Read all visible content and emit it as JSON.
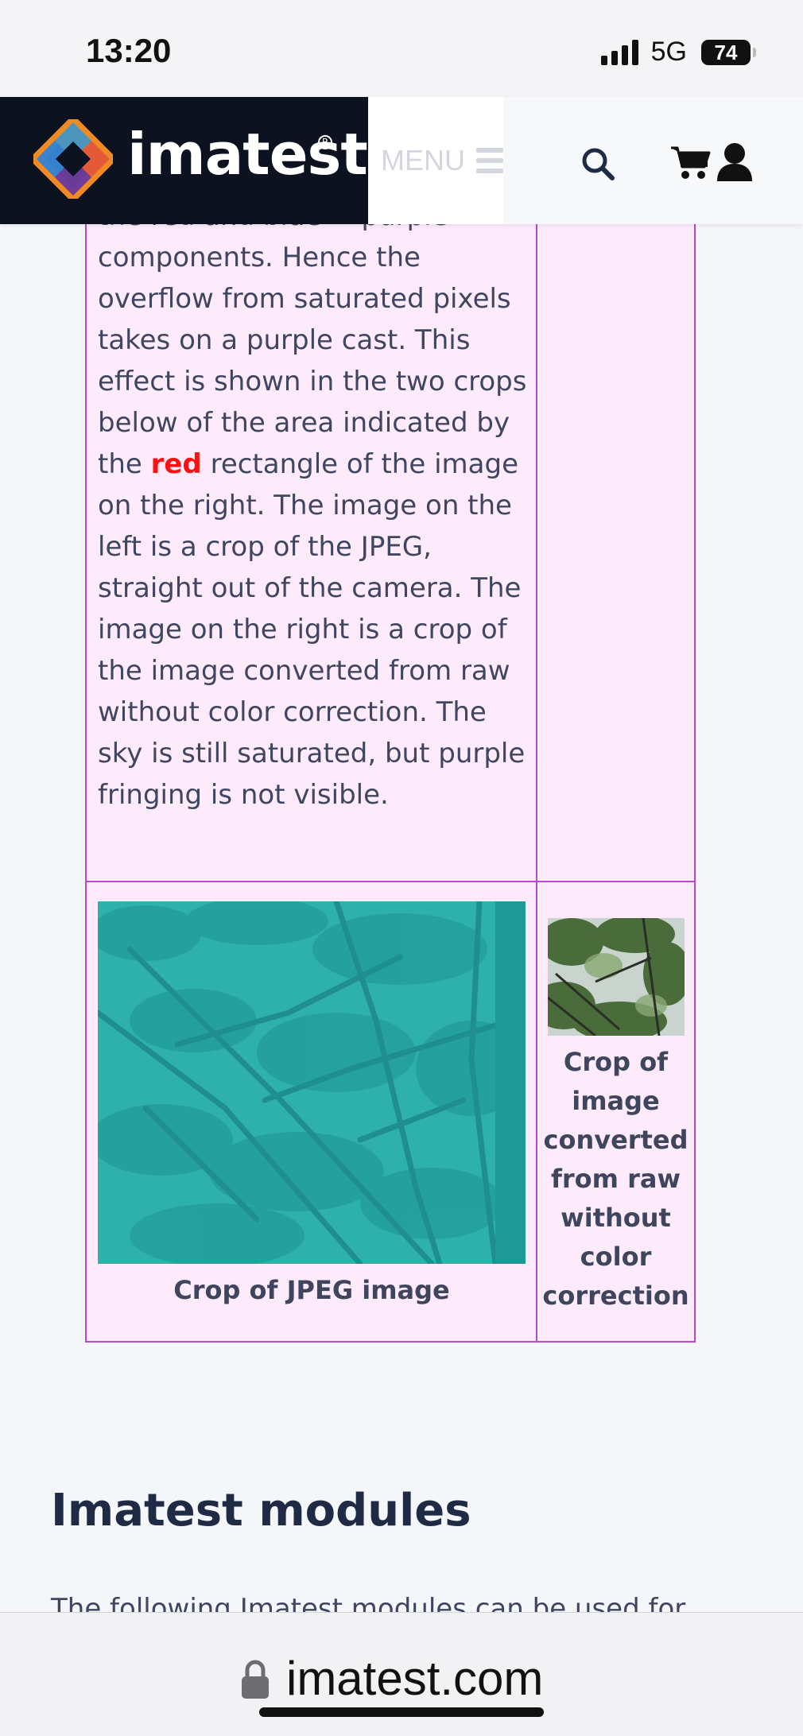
{
  "status_bar": {
    "time": "13:20",
    "network": "5G",
    "battery": "74"
  },
  "header": {
    "logo_text": "imatest",
    "menu_label": "MENU",
    "icons": [
      "logo-mark",
      "hamburger-icon",
      "search-icon",
      "cart-icon",
      "user-icon"
    ]
  },
  "article": {
    "paragraph_before_red": "the red and blue = purple components. Hence the overflow from saturated pixels takes on a purple cast. This effect is shown in the two crops below of the area indicated by the ",
    "paragraph_red": "red",
    "paragraph_after_red": " rectangle of the image on the right. The image on the left is a crop of the JPEG, straight out of the camera. The image on the right is a crop of the image converted from raw without color correction. The sky is still saturated, but purple fringing is not visible.",
    "caption_left": "Crop of JPEG image",
    "caption_right": "Crop of image converted from raw without color correction"
  },
  "modules": {
    "heading": "Imatest modules",
    "intro_partial": "The following Imatest modules can be used for"
  },
  "browser": {
    "url": "imatest.com"
  },
  "colors": {
    "table_border": "#b64ac8",
    "table_bg": "#fdebfb",
    "highlight_red": "#ff1010",
    "logo_bg": "#0c1220",
    "heading": "#1f2a44"
  }
}
